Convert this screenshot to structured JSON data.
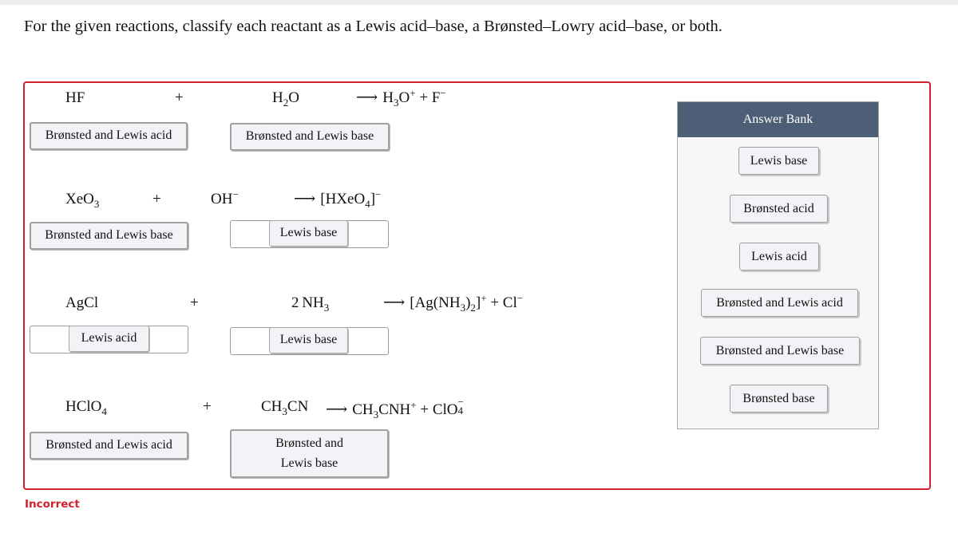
{
  "instruction": "For the given reactions, classify each reactant as a Lewis acid–base, a Brønsted–Lowry acid–base, or both.",
  "reactions": [
    {
      "reactant1": {
        "formula": "HF",
        "answer": "Brønsted and Lewis acid"
      },
      "plus": "+",
      "reactant2": {
        "formula_main": "H",
        "formula_sub": "2",
        "formula_tail": "O",
        "answer": "Brønsted and Lewis base"
      },
      "arrow": "⟶",
      "products": {
        "p1_main": "H",
        "p1_sub": "3",
        "p1_tail": "O",
        "p1_sup": "+",
        "sep": " + ",
        "p2_main": "F",
        "p2_sup": "−"
      }
    },
    {
      "reactant1": {
        "formula_main": "XeO",
        "formula_sub": "3",
        "answer": "Brønsted and Lewis base"
      },
      "plus": "+",
      "reactant2": {
        "formula_main": "OH",
        "formula_sup": "−",
        "answer": "Lewis base"
      },
      "arrow": "⟶",
      "products": {
        "p1_main": "[HXeO",
        "p1_sub": "4",
        "p1_tail": "]",
        "p1_sup": "−"
      }
    },
    {
      "reactant1": {
        "formula": "AgCl",
        "answer": "Lewis acid"
      },
      "plus": "+",
      "reactant2": {
        "formula_main": "2 NH",
        "formula_sub": "3",
        "answer": "Lewis base"
      },
      "arrow": "⟶",
      "products": {
        "p1_a": "[Ag(NH",
        "p1_sub1": "3",
        "p1_b": ")",
        "p1_sub2": "2",
        "p1_c": "]",
        "p1_sup": "+",
        "sep": " + ",
        "p2_main": "Cl",
        "p2_sup": "−"
      }
    },
    {
      "reactant1": {
        "formula_main": "HClO",
        "formula_sub": "4",
        "answer": "Brønsted and Lewis acid"
      },
      "plus": "+",
      "reactant2": {
        "formula_main": "CH",
        "formula_sub": "3",
        "formula_tail": "CN",
        "answer_line1": "Brønsted and",
        "answer_line2": "Lewis base"
      },
      "arrow": "⟶",
      "products": {
        "p1_main": "CH",
        "p1_sub": "3",
        "p1_tail": "CNH",
        "p1_sup": "+",
        "sep": " + ",
        "p2_main": "ClO",
        "p2_sup": "−",
        "p2_sub": "4"
      }
    }
  ],
  "answer_bank": {
    "title": "Answer Bank",
    "items": [
      "Lewis base",
      "Brønsted acid",
      "Lewis acid",
      "Brønsted and Lewis acid",
      "Brønsted and Lewis base",
      "Brønsted base"
    ]
  },
  "status": {
    "text": "Incorrect",
    "color": "#d3202a"
  },
  "colors": {
    "frame": "#d3202a",
    "bank_header": "#4d5e77"
  }
}
